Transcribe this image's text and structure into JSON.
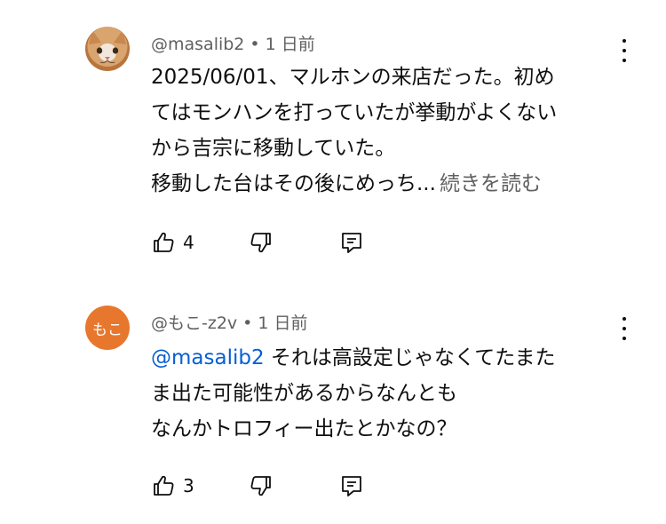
{
  "comments": [
    {
      "handle": "@masalib2",
      "separator": "•",
      "time": "1 日前",
      "body_lines": [
        "2025/06/01、マルホンの来店だった。初め",
        "てはモンハンを打っていたが挙動がよくない",
        "から吉宗に移動していた。",
        "移動した台はその後にめっち..."
      ],
      "more_label": "続きを読む",
      "likes": "4",
      "avatar_icon": "cat-photo-avatar",
      "menu_icon": "more-vert-icon"
    },
    {
      "handle": "@もこ-z2v",
      "separator": "•",
      "time": "1 日前",
      "avatar_text": "もこ",
      "avatar_color": "#e8772e",
      "mention": "@masalib2",
      "body_lines": [
        " それは高設定じゃなくてたまた",
        "ま出た可能性があるからなんとも",
        "なんかトロフィー出たとかなの？"
      ],
      "likes": "3",
      "menu_icon": "more-vert-icon"
    }
  ],
  "colors": {
    "text": "#0f0f0f",
    "secondary": "#606060",
    "mention": "#065fd4"
  }
}
